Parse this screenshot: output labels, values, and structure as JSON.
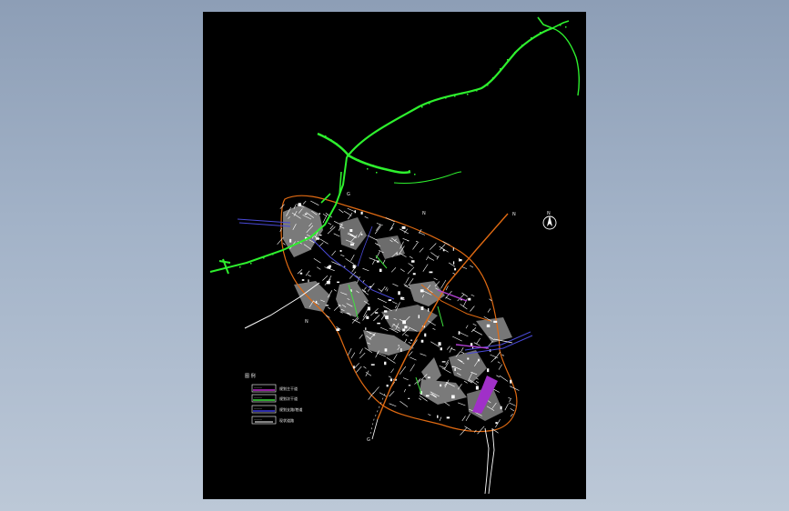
{
  "drawing": {
    "labels": {
      "north_arrow_letter": "N",
      "road_label_nw": "G",
      "road_label_n": "N",
      "road_label_ne": "N",
      "road_label_w": "N",
      "road_label_s": "G"
    },
    "legend": {
      "title": "图 例",
      "items": [
        {
          "swatch_label": "———",
          "text": "规划主干道",
          "color": "#c02ad0"
        },
        {
          "swatch_label": "———",
          "text": "规划次干道",
          "color": "#3ee13e"
        },
        {
          "swatch_label": "———",
          "text": "规划支路/巷道",
          "color": "#3a3ae0"
        },
        {
          "swatch_label": "———",
          "text": "现状道路",
          "color": "#ffffff"
        }
      ]
    },
    "colors": {
      "background": "#000000",
      "boundary": "#e06a12",
      "highway": "#2ef02e",
      "road_blue": "#4a4ad8",
      "road_purple": "#b040d0",
      "district_fill": "#777777",
      "street_grid": "#ffffff"
    }
  }
}
